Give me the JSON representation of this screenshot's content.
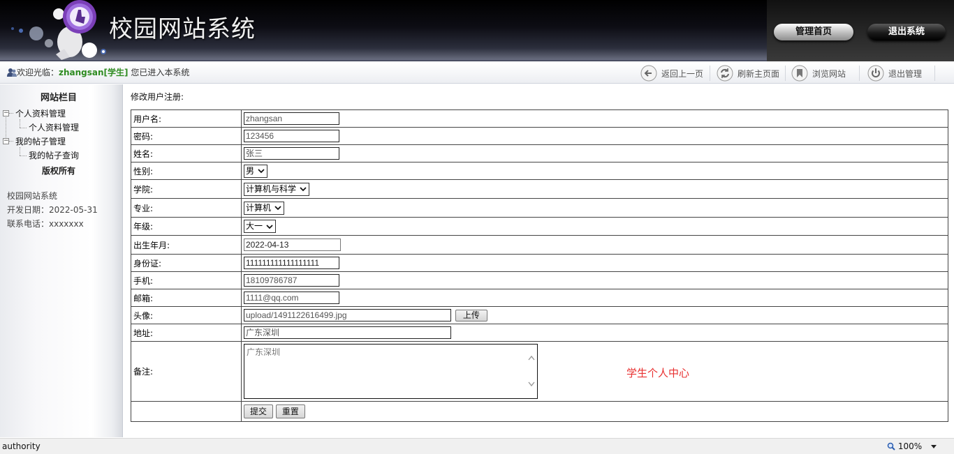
{
  "header": {
    "site_title": "校园网站系统",
    "buttons": {
      "admin_home": "管理首页",
      "exit_system": "退出系统"
    }
  },
  "welcome": {
    "prefix": "欢迎光临：",
    "user": "zhangsan[学生]",
    "suffix": " 您已进入本系统"
  },
  "toolbar": {
    "back": "返回上一页",
    "refresh": "刷新主页面",
    "browse_site": "浏览网站",
    "exit_admin": "退出管理"
  },
  "sidebar": {
    "title": "网站栏目",
    "tree": [
      {
        "label": "个人资料管理",
        "children": [
          "个人资料管理"
        ]
      },
      {
        "label": "我的帖子管理",
        "children": [
          "我的帖子查询"
        ]
      }
    ],
    "copyright_title": "版权所有",
    "info": [
      "校园网站系统",
      "开发日期：2022-05-31",
      "联系电话：xxxxxxx"
    ]
  },
  "form": {
    "heading": "修改用户注册:",
    "fields": {
      "username": {
        "label": "用户名:",
        "value": "zhangsan"
      },
      "password": {
        "label": "密码:",
        "value": "123456"
      },
      "name": {
        "label": "姓名:",
        "value": "张三"
      },
      "gender": {
        "label": "性别:",
        "value": "男"
      },
      "college": {
        "label": "学院:",
        "value": "计算机与科学"
      },
      "major": {
        "label": "专业:",
        "value": "计算机"
      },
      "grade": {
        "label": "年级:",
        "value": "大一"
      },
      "birthdate": {
        "label": "出生年月:",
        "value": "2022-04-13"
      },
      "id_card": {
        "label": "身份证:",
        "value": "111111111111111111"
      },
      "phone": {
        "label": "手机:",
        "value": "18109786787"
      },
      "email": {
        "label": "邮箱:",
        "value": "1111@qq.com"
      },
      "avatar": {
        "label": "头像:",
        "value": "upload/1491122616499.jpg",
        "upload_label": "上传"
      },
      "address": {
        "label": "地址:",
        "value": "广东深圳"
      },
      "remarks": {
        "label": "备注:",
        "value": "广东深圳"
      }
    },
    "submit_label": "提交",
    "reset_label": "重置",
    "student_center": "学生个人中心"
  },
  "statusbar": {
    "text": "authority",
    "zoom": "100%"
  },
  "colors": {
    "welcome_user": "#2e8b20",
    "student_center": "#e83030"
  }
}
